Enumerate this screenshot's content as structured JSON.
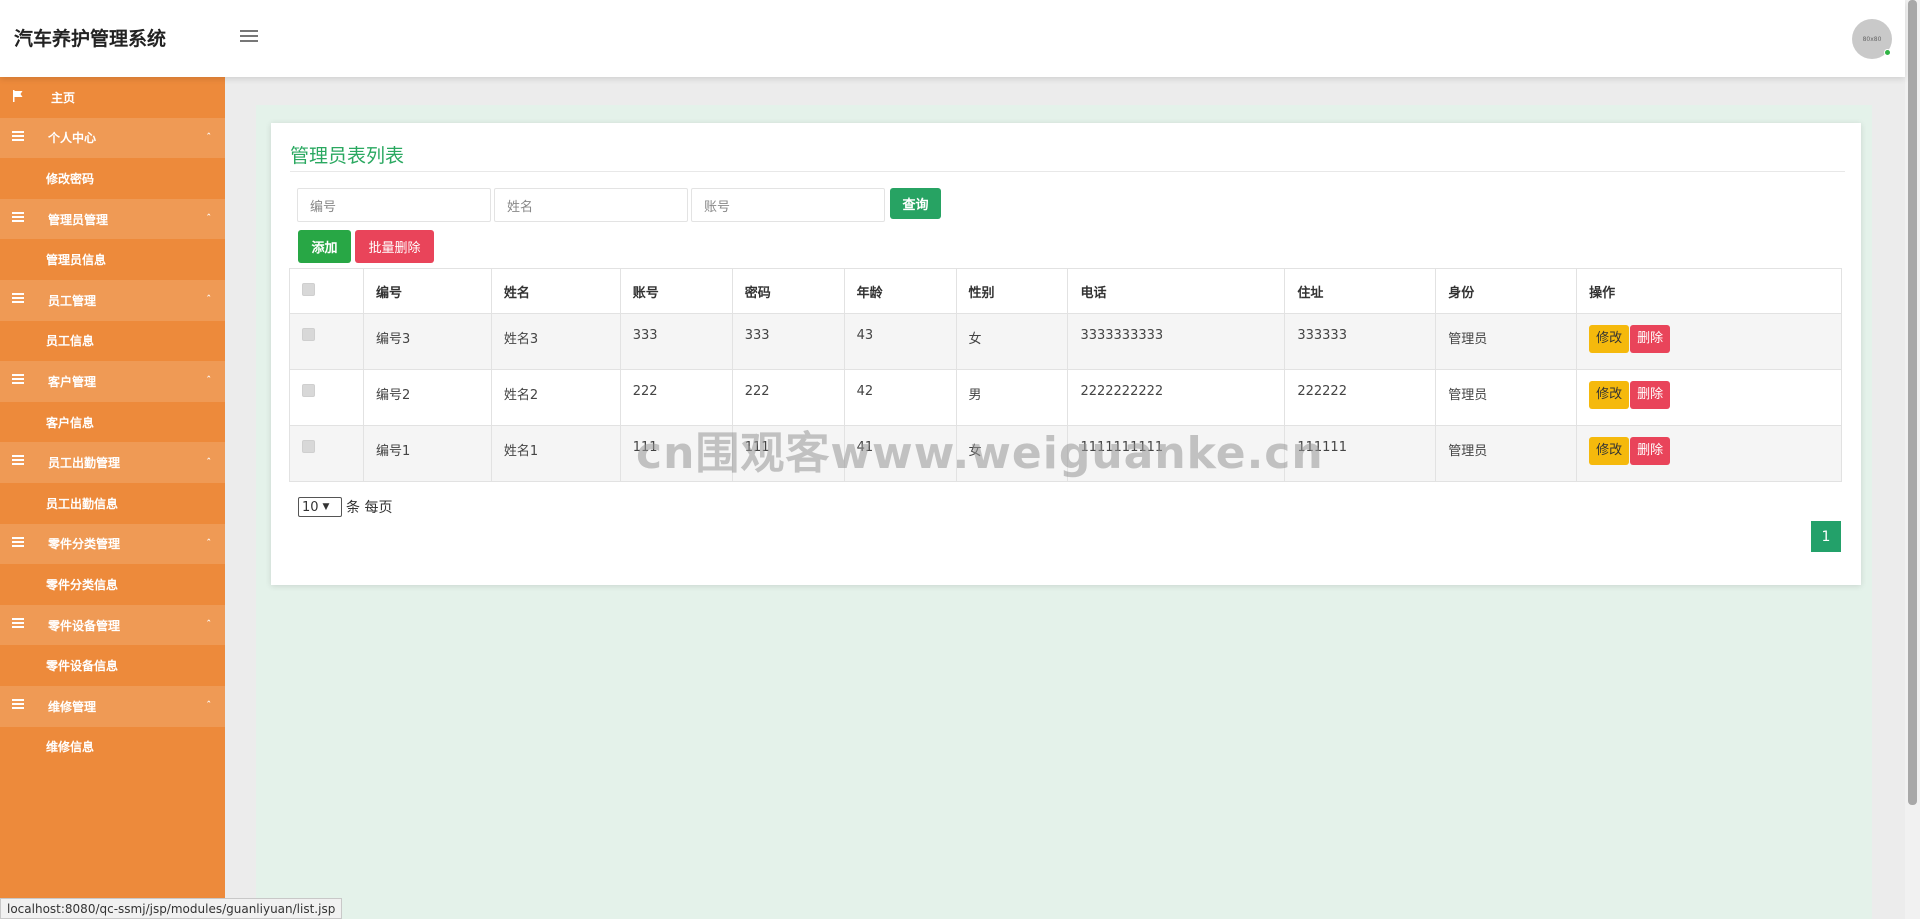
{
  "header": {
    "app_title": "汽车养护管理系统",
    "avatar_text": "80x80"
  },
  "sidebar": {
    "items": [
      {
        "label": "主页",
        "icon": "flag-icon",
        "type": "home"
      },
      {
        "label": "个人中心",
        "icon": "list-icon",
        "type": "group"
      },
      {
        "label": "修改密码",
        "type": "sub"
      },
      {
        "label": "管理员管理",
        "icon": "list-icon",
        "type": "group"
      },
      {
        "label": "管理员信息",
        "type": "sub"
      },
      {
        "label": "员工管理",
        "icon": "list-icon",
        "type": "group"
      },
      {
        "label": "员工信息",
        "type": "sub"
      },
      {
        "label": "客户管理",
        "icon": "list-icon",
        "type": "group"
      },
      {
        "label": "客户信息",
        "type": "sub"
      },
      {
        "label": "员工出勤管理",
        "icon": "list-icon",
        "type": "group"
      },
      {
        "label": "员工出勤信息",
        "type": "sub"
      },
      {
        "label": "零件分类管理",
        "icon": "list-icon",
        "type": "group"
      },
      {
        "label": "零件分类信息",
        "type": "sub"
      },
      {
        "label": "零件设备管理",
        "icon": "list-icon",
        "type": "group"
      },
      {
        "label": "零件设备信息",
        "type": "sub"
      },
      {
        "label": "维修管理",
        "icon": "list-icon",
        "type": "group"
      },
      {
        "label": "维修信息",
        "type": "sub"
      }
    ]
  },
  "main": {
    "title": "管理员表列表",
    "search": {
      "code_placeholder": "编号",
      "name_placeholder": "姓名",
      "account_placeholder": "账号",
      "query_label": "查询"
    },
    "actions": {
      "add_label": "添加",
      "batch_delete_label": "批量删除"
    },
    "table": {
      "columns": [
        "编号",
        "姓名",
        "账号",
        "密码",
        "年龄",
        "性别",
        "电话",
        "住址",
        "身份",
        "操作"
      ],
      "rows": [
        {
          "code": "编号3",
          "name": "姓名3",
          "account": "333",
          "password": "333",
          "age": "43",
          "gender": "女",
          "phone": "3333333333",
          "address": "333333",
          "role": "管理员"
        },
        {
          "code": "编号2",
          "name": "姓名2",
          "account": "222",
          "password": "222",
          "age": "42",
          "gender": "男",
          "phone": "2222222222",
          "address": "222222",
          "role": "管理员"
        },
        {
          "code": "编号1",
          "name": "姓名1",
          "account": "111",
          "password": "111",
          "age": "41",
          "gender": "女",
          "phone": "1111111111",
          "address": "111111",
          "role": "管理员"
        }
      ],
      "edit_label": "修改",
      "delete_label": "删除"
    },
    "pager": {
      "page_size": "10",
      "page_size_suffix": "条 每页",
      "current_page": "1"
    }
  },
  "watermark": "cn围观客www.weiguanke.cn",
  "statusbar": {
    "url": "localhost:8080/qc-ssmj/jsp/modules/guanliyuan/list.jsp"
  },
  "colors": {
    "sidebar_bg": "#ed8a3b",
    "accent_green": "#2aa860",
    "danger": "#e9445a",
    "warning": "#f5b90c"
  }
}
